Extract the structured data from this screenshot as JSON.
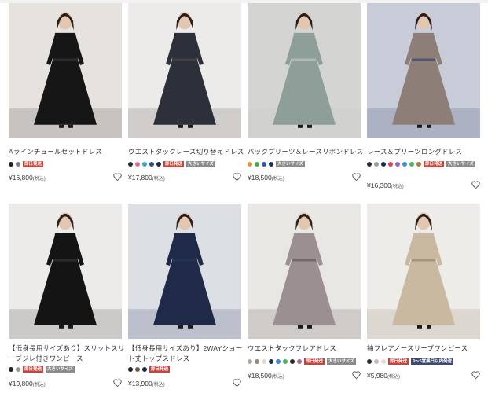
{
  "products": [
    {
      "name": "Aラインチュールセットドレス",
      "swatches": [
        "#222222",
        "#7a7f84"
      ],
      "badges": [
        {
          "text": "即日発送",
          "style": "red"
        }
      ],
      "price": "¥16,800",
      "tax": "(税込)",
      "photo": {
        "bg": "#e6e2de",
        "dress": "#161616",
        "accent": "#3a3a3a"
      }
    },
    {
      "name": "ウエストタックレース切り替えドレス",
      "swatches": [
        "#2a2a2a",
        "#e06a9a",
        "#3aa6c9",
        "#2f4a7c",
        "#1b2b4f"
      ],
      "badges": [
        {
          "text": "即日発送",
          "style": "red"
        },
        {
          "text": "大きいサイズ",
          "style": "gray"
        }
      ],
      "price": "¥17,800",
      "tax": "(税込)",
      "photo": {
        "bg": "#ecebea",
        "dress": "#2b303a",
        "accent": "#5a4a42"
      }
    },
    {
      "name": "バックプリーツ＆レースリボンドレス",
      "swatches": [
        "#e8912e",
        "#4ea848",
        "#2b5aa8",
        "#1f2f55"
      ],
      "badges": [
        {
          "text": "大きいサイズ",
          "style": "gray"
        }
      ],
      "price": "¥18,500",
      "tax": "(税込)",
      "photo": {
        "bg": "#d4d4d2",
        "dress": "#8e9f9a",
        "accent": "#c9c9c5"
      }
    },
    {
      "name": "レース＆プリーツロングドレス",
      "swatches": [
        "#2a2a2a",
        "#9b9b9b",
        "#1c2d55",
        "#d6425f",
        "#8a6cc2",
        "#3e8fd6",
        "#4db860",
        "#b07a4a"
      ],
      "badges": [
        {
          "text": "即日発送",
          "style": "red"
        },
        {
          "text": "大きいサイズ",
          "style": "gray"
        }
      ],
      "price": "¥16,300",
      "tax": "(税込)",
      "photo": {
        "bg": "#c8ccd8",
        "dress": "#8d7f78",
        "accent": "#2c3c6a"
      }
    },
    {
      "name": "【低身長用サイズあり】スリットスリーブジレ付きワンピース",
      "swatches": [
        "#222222",
        "#9a9a9a"
      ],
      "badges": [
        {
          "text": "即日発送",
          "style": "red"
        },
        {
          "text": "大きいサイズ",
          "style": "gray"
        }
      ],
      "price": "¥19,800",
      "tax": "(税込)",
      "photo": {
        "bg": "#ecebea",
        "dress": "#141414",
        "accent": "#3a3a3a"
      }
    },
    {
      "name": "【低身長用サイズあり】2WAYショート丈トップスドレス",
      "swatches": [
        "#222222",
        "#6b5a44",
        "#1d2b4c"
      ],
      "badges": [
        {
          "text": "即日発送",
          "style": "red"
        }
      ],
      "price": "¥13,900",
      "tax": "(税込)",
      "photo": {
        "bg": "#dcdfe4",
        "dress": "#1e2a48",
        "accent": "#2b3a60"
      }
    },
    {
      "name": "ウエストタックフレアドレス",
      "swatches": [
        "#b2aaa2",
        "#8e8a86",
        "#e8d8c8",
        "#1f2f55",
        "#2e8fd0",
        "#4fb060",
        "#2a2a2a",
        "#a56a8a"
      ],
      "badges": [
        {
          "text": "即日発送",
          "style": "red"
        },
        {
          "text": "大きいサイズ",
          "style": "gray"
        }
      ],
      "price": "¥18,500",
      "tax": "(税込)",
      "photo": {
        "bg": "#e9e7e3",
        "dress": "#9c8f91",
        "accent": "#5b4d4f"
      }
    },
    {
      "name": "袖フレアノースリーブワンピース",
      "swatches": [
        "#2a2a2a",
        "#bdbdbd",
        "#e4dcc8"
      ],
      "badges": [
        {
          "text": "即日発送",
          "style": "red"
        },
        {
          "text": "3〜5営業日以内発送",
          "style": "navy"
        }
      ],
      "price": "¥5,980",
      "tax": "(税込)",
      "photo": {
        "bg": "#eeece8",
        "dress": "#c9b9a0",
        "accent": "#8c7b66"
      }
    }
  ]
}
